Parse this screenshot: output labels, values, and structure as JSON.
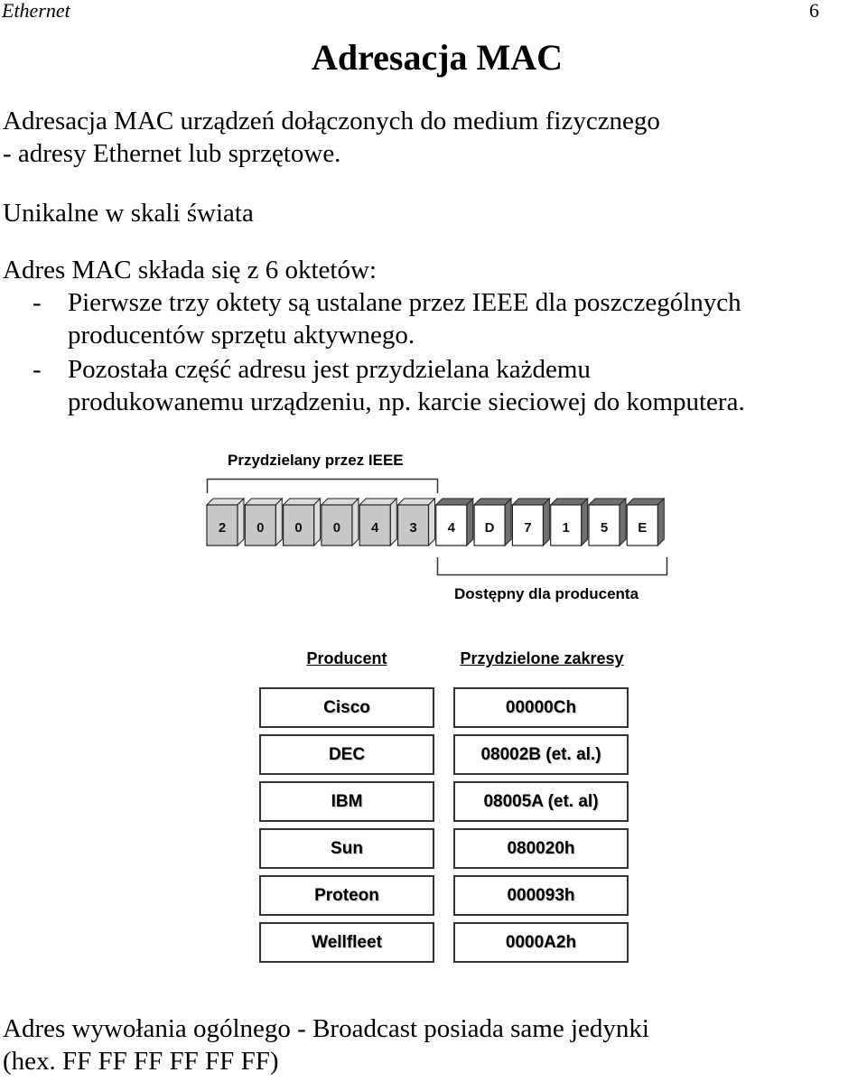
{
  "header": {
    "section": "Ethernet",
    "page_number": "6"
  },
  "title": "Adresacja MAC",
  "paragraphs": {
    "intro_line1": "Adresacja MAC urządzeń dołączonych do medium fizycznego",
    "intro_line2": "- adresy Ethernet lub sprzętowe.",
    "unique": "Unikalne w skali świata",
    "octets_intro": "Adres MAC składa się z 6 oktetów:",
    "bullet_marker": "-",
    "bullets": [
      {
        "line1": "Pierwsze trzy oktety są ustalane przez IEEE dla poszczególnych",
        "line2": "producentów sprzętu aktywnego."
      },
      {
        "line1": "Pozostała część adresu jest przydzielana każdemu",
        "line2": "produkowanemu urządzeniu, np. karcie sieciowej do komputera."
      }
    ],
    "broadcast_line1": "Adres wywołania ogólnego - Broadcast posiada same jedynki",
    "broadcast_line2": "(hex. FF FF FF FF FF FF)"
  },
  "mac_diagram": {
    "ieee_label": "Przydzielany przez IEEE",
    "vendor_label": "Dostępny dla producenta",
    "digits": [
      "2",
      "0",
      "0",
      "0",
      "4",
      "3",
      "4",
      "D",
      "7",
      "1",
      "5",
      "E"
    ],
    "ieee_digit_count": 6,
    "colors": {
      "ieee_face": "#c8c8c8",
      "ieee_side": "#dcdcdc",
      "vendor_face": "#ffffff",
      "vendor_side": "#707070",
      "outline": "#222222"
    }
  },
  "vendor_table": {
    "headers": [
      "Producent",
      "Przydzielone zakresy"
    ],
    "rows": [
      {
        "producer": "Cisco",
        "range": "00000Ch"
      },
      {
        "producer": "DEC",
        "range": "08002B (et. al.)"
      },
      {
        "producer": "IBM",
        "range": "08005A (et. al)"
      },
      {
        "producer": "Sun",
        "range": "080020h"
      },
      {
        "producer": "Proteon",
        "range": "000093h"
      },
      {
        "producer": "Wellfleet",
        "range": "0000A2h"
      }
    ]
  }
}
